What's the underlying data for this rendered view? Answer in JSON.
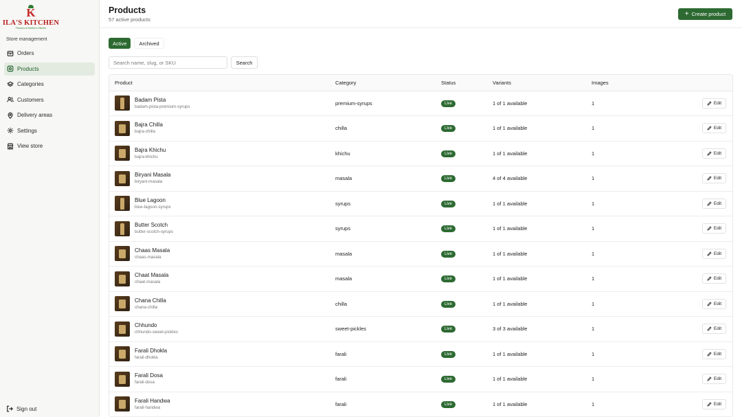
{
  "brand": {
    "name": "ILA'S KITCHEN",
    "tagline": "Flavours of Mother's Kitchen",
    "primary_color": "#2d6a32",
    "logo_color": "#b71c1c"
  },
  "sidebar": {
    "section_label": "Store management",
    "items": [
      {
        "label": "Orders",
        "icon": "box-icon",
        "active": false
      },
      {
        "label": "Products",
        "icon": "tag-icon",
        "active": true
      },
      {
        "label": "Categories",
        "icon": "layers-icon",
        "active": false
      },
      {
        "label": "Customers",
        "icon": "users-icon",
        "active": false
      },
      {
        "label": "Delivery areas",
        "icon": "map-pin-icon",
        "active": false
      },
      {
        "label": "Settings",
        "icon": "gear-icon",
        "active": false
      },
      {
        "label": "View store",
        "icon": "store-icon",
        "active": false
      }
    ],
    "sign_out": "Sign out"
  },
  "header": {
    "title": "Products",
    "subtitle": "57 active products",
    "create_label": "Create product"
  },
  "tabs": [
    {
      "label": "Active",
      "active": true
    },
    {
      "label": "Archived",
      "active": false
    }
  ],
  "search": {
    "placeholder": "Search name, slug, or SKU",
    "value": "",
    "button": "Search"
  },
  "table": {
    "columns": [
      "Product",
      "Category",
      "Status",
      "Variants",
      "Images",
      ""
    ],
    "edit_label": "Edit",
    "rows": [
      {
        "name": "Badam Pista",
        "slug": "badam-pista-premium-syrups",
        "category": "premium-syrups",
        "status": "Live",
        "variants": "1 of 1 available",
        "images": "1"
      },
      {
        "name": "Bajra Chilla",
        "slug": "bajra-chilla",
        "category": "chilla",
        "status": "Live",
        "variants": "1 of 1 available",
        "images": "1"
      },
      {
        "name": "Bajra Khichu",
        "slug": "bajra-khichu",
        "category": "khichu",
        "status": "Live",
        "variants": "1 of 1 available",
        "images": "1"
      },
      {
        "name": "Biryani Masala",
        "slug": "biryani-masala",
        "category": "masala",
        "status": "Live",
        "variants": "4 of 4 available",
        "images": "1"
      },
      {
        "name": "Blue Lagoon",
        "slug": "blue-lagoon-syrups",
        "category": "syrups",
        "status": "Live",
        "variants": "1 of 1 available",
        "images": "1"
      },
      {
        "name": "Butter Scotch",
        "slug": "butter-scotch-syrups",
        "category": "syrups",
        "status": "Live",
        "variants": "1 of 1 available",
        "images": "1"
      },
      {
        "name": "Chaas Masala",
        "slug": "chaas-masala",
        "category": "masala",
        "status": "Live",
        "variants": "1 of 1 available",
        "images": "1"
      },
      {
        "name": "Chaat Masala",
        "slug": "chaat-masala",
        "category": "masala",
        "status": "Live",
        "variants": "1 of 1 available",
        "images": "1"
      },
      {
        "name": "Chana Chilla",
        "slug": "chana-chilla",
        "category": "chilla",
        "status": "Live",
        "variants": "1 of 1 available",
        "images": "1"
      },
      {
        "name": "Chhundo",
        "slug": "chhundo-sweet-pickles",
        "category": "sweet-pickles",
        "status": "Live",
        "variants": "3 of 3 available",
        "images": "1"
      },
      {
        "name": "Farali Dhokla",
        "slug": "farali-dhokla",
        "category": "farali",
        "status": "Live",
        "variants": "1 of 1 available",
        "images": "1"
      },
      {
        "name": "Farali Dosa",
        "slug": "farali-dosa",
        "category": "farali",
        "status": "Live",
        "variants": "1 of 1 available",
        "images": "1"
      },
      {
        "name": "Farali Handwa",
        "slug": "farali-handwa",
        "category": "farali",
        "status": "Live",
        "variants": "1 of 1 available",
        "images": "1"
      }
    ]
  }
}
